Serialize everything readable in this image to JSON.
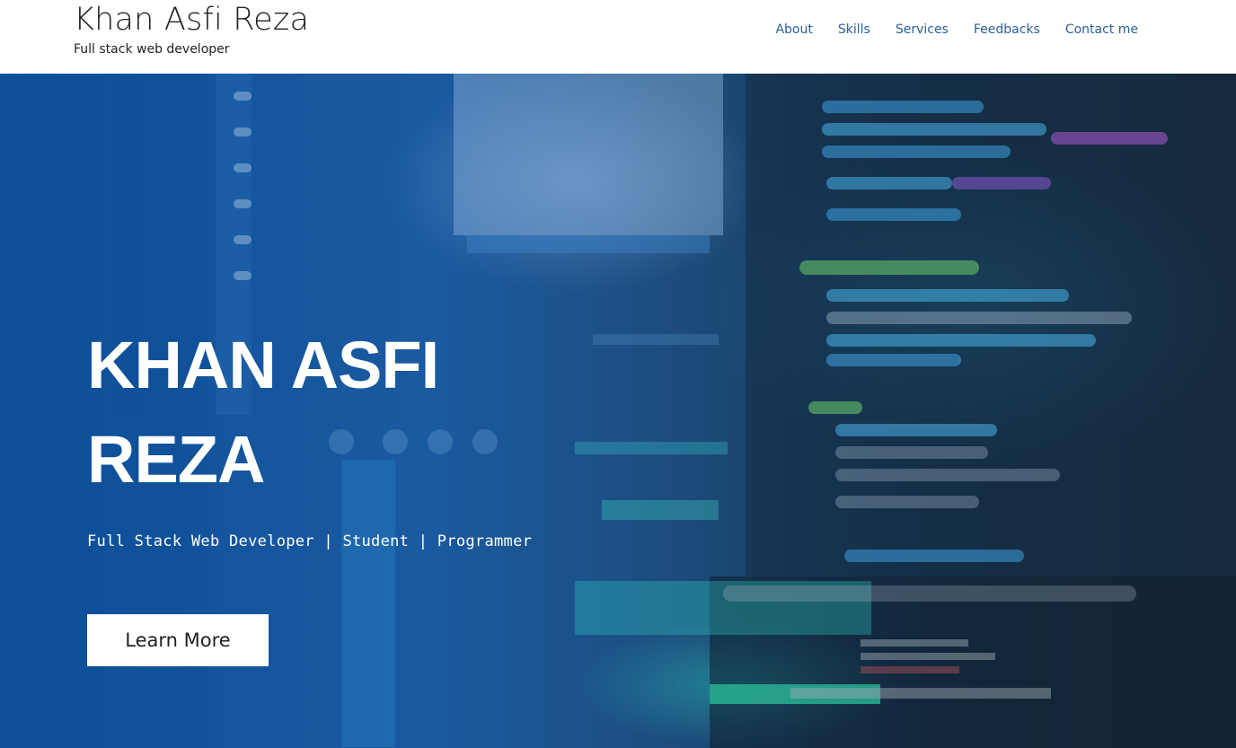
{
  "header": {
    "brand_title": "Khan Asfi Reza",
    "brand_subtitle": "Full stack web developer",
    "nav": [
      {
        "label": "About"
      },
      {
        "label": "Skills"
      },
      {
        "label": "Services"
      },
      {
        "label": "Feedbacks"
      },
      {
        "label": "Contact me"
      }
    ]
  },
  "hero": {
    "title_line1": "KHAN ASFI",
    "title_line2": "REZA",
    "subtitle": "Full Stack Web Developer | Student | Programmer",
    "cta_label": "Learn More",
    "background_image": "blurred-code-editor-screens"
  },
  "colors": {
    "nav_link": "#2b5d9b",
    "hero_blue": "#1a5aa0",
    "text_dark": "#222222"
  }
}
